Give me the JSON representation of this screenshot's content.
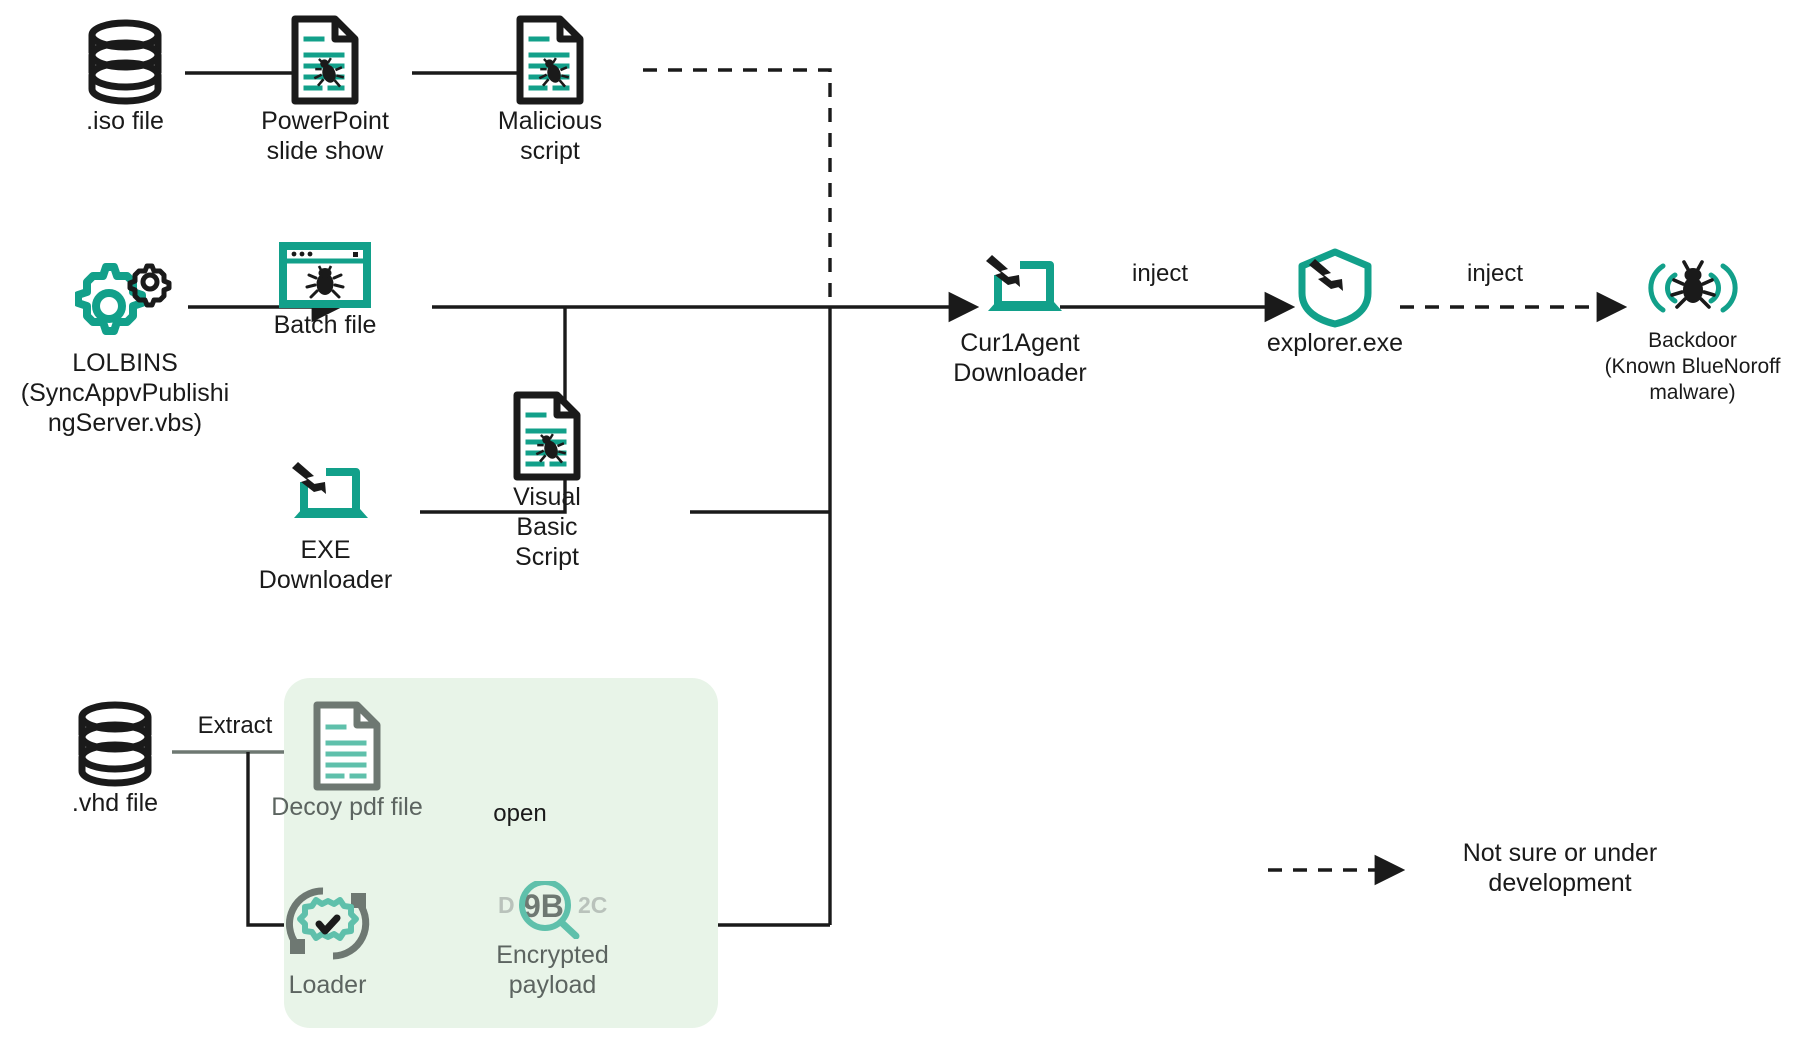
{
  "diagram": {
    "title": "BlueNoroff infection chain",
    "colors": {
      "teal": "#12a08a",
      "black": "#1a1a1a",
      "grey": "#6e7872",
      "grey_light": "#8d968f",
      "mint_panel": "#e8f4e8",
      "white": "#ffffff"
    },
    "panel": {
      "name": "loader-stage-panel",
      "fill": "#e8f4e8"
    }
  },
  "nodes": {
    "iso_file": {
      "label": ".iso file",
      "icon": "database-icon"
    },
    "powerpoint": {
      "label": "PowerPoint\nslide show",
      "icon": "document-bug-icon"
    },
    "malicious_script": {
      "label": "Malicious script",
      "icon": "document-bug-icon"
    },
    "lolbins": {
      "label": "LOLBINS\n(SyncAppvPublishi\nngServer.vbs)",
      "icon": "gears-icon"
    },
    "batch_file": {
      "label": "Batch file",
      "icon": "browser-bug-icon"
    },
    "exe_downloader": {
      "label": "EXE\nDownloader",
      "icon": "laptop-download-icon"
    },
    "vbs": {
      "label": "Visual Basic\nScript",
      "icon": "document-bug-icon"
    },
    "cur1agent": {
      "label": "Cur1Agent\nDownloader",
      "icon": "laptop-download-icon"
    },
    "explorer": {
      "label": "explorer.exe",
      "icon": "shield-download-icon"
    },
    "backdoor": {
      "label": "Backdoor\n(Known BlueNoroff\nmalware)",
      "icon": "bug-signal-icon"
    },
    "vhd_file": {
      "label": ".vhd file",
      "icon": "database-icon"
    },
    "decoy_pdf": {
      "label": "Decoy pdf file",
      "icon": "document-lines-icon"
    },
    "loader": {
      "label": "Loader",
      "icon": "refresh-check-icon"
    },
    "encrypted_payload": {
      "label": "Encrypted\npayload",
      "icon": "hex-magnifier-icon",
      "hex_left": "D",
      "hex_mid": "9B",
      "hex_right": "2C"
    }
  },
  "edge_labels": {
    "inject_1": "inject",
    "inject_2": "inject",
    "extract": "Extract",
    "open": "open"
  },
  "legend": {
    "text": "Not sure or under\ndevelopment",
    "marker": "dashed-arrow-icon"
  }
}
